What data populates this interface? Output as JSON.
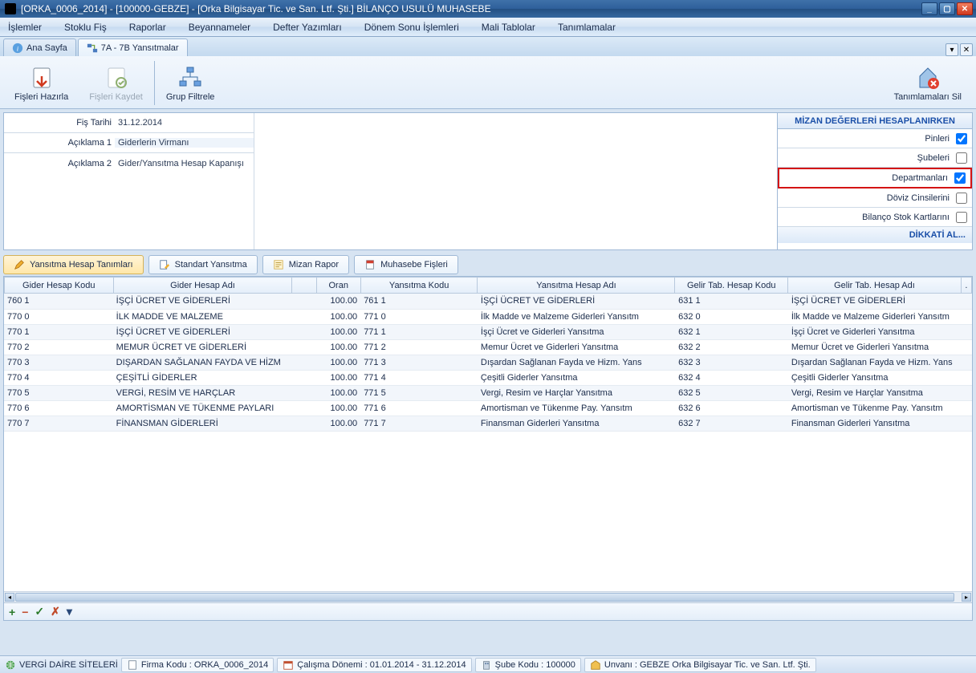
{
  "window": {
    "title": "[ORKA_0006_2014]   -   [100000-GEBZE]   -   [Orka Bilgisayar Tic. ve San. Ltf. Şti.]        BİLANÇO USULÜ MUHASEBE"
  },
  "menu": {
    "items": [
      "İşlemler",
      "Stoklu Fiş",
      "Raporlar",
      "Beyannameler",
      "Defter Yazımları",
      "Dönem Sonu İşlemleri",
      "Mali Tablolar",
      "Tanımlamalar"
    ]
  },
  "doc_tabs": {
    "items": [
      {
        "label": "Ana Sayfa",
        "active": false
      },
      {
        "label": "7A - 7B Yansıtmalar",
        "active": true
      }
    ]
  },
  "ribbon": {
    "fisleri_hazirla": "Fişleri Hazırla",
    "fisleri_kaydet": "Fişleri Kaydet",
    "grup_filtrele": "Grup Filtrele",
    "tanimlamalari_sil": "Tanımlamaları Sil"
  },
  "voucher": {
    "fis_tarihi_label": "Fiş Tarihi",
    "fis_tarihi": "31.12.2014",
    "aciklama1_label": "Açıklama 1",
    "aciklama1": "Giderlerin Virmanı",
    "aciklama2_label": "Açıklama 2",
    "aciklama2": "Gider/Yansıtma Hesap Kapanışı"
  },
  "mizan_panel": {
    "header": "MİZAN DEĞERLERİ HESAPLANIRKEN",
    "rows": [
      {
        "label": "Pinleri",
        "checked": true,
        "highlight": false
      },
      {
        "label": "Şubeleri",
        "checked": false,
        "highlight": false
      },
      {
        "label": "Departmanları",
        "checked": true,
        "highlight": true
      },
      {
        "label": "Döviz Cinsilerini",
        "checked": false,
        "highlight": false
      },
      {
        "label": "Bilanço Stok Kartlarını",
        "checked": false,
        "highlight": false
      }
    ],
    "footer": "DİKKATİ AL..."
  },
  "view_tabs": {
    "items": [
      {
        "label": "Yansıtma Hesap Tanımları",
        "active": true
      },
      {
        "label": "Standart Yansıtma",
        "active": false
      },
      {
        "label": "Mizan Rapor",
        "active": false
      },
      {
        "label": "Muhasebe Fişleri",
        "active": false
      }
    ]
  },
  "grid": {
    "headers": {
      "gider_kodu": "Gider Hesap Kodu",
      "gider_adi": "Gider Hesap Adı",
      "blank": "",
      "oran": "Oran",
      "yansitma_kodu": "Yansıtma Kodu",
      "yansitma_adi": "Yansıtma Hesap Adı",
      "gelir_kodu": "Gelir Tab. Hesap Kodu",
      "gelir_adi": "Gelir Tab. Hesap Adı",
      "last": "."
    },
    "rows": [
      {
        "gk": "760 1",
        "ga": "İŞÇİ ÜCRET VE GİDERLERİ",
        "oran": "100.00",
        "yk": "761 1",
        "ya": "İŞÇİ ÜCRET VE GİDERLERİ",
        "glk": "631 1",
        "gla": "İŞÇİ ÜCRET VE GİDERLERİ"
      },
      {
        "gk": "770 0",
        "ga": "İLK MADDE VE MALZEME",
        "oran": "100.00",
        "yk": "771 0",
        "ya": "İlk Madde ve Malzeme Giderleri Yansıtm",
        "glk": "632 0",
        "gla": "İlk Madde ve Malzeme Giderleri Yansıtm"
      },
      {
        "gk": "770 1",
        "ga": "İŞÇİ ÜCRET VE GİDERLERİ",
        "oran": "100.00",
        "yk": "771 1",
        "ya": "İşçi Ücret ve Giderleri Yansıtma",
        "glk": "632 1",
        "gla": "İşçi Ücret ve Giderleri Yansıtma"
      },
      {
        "gk": "770 2",
        "ga": "MEMUR ÜCRET VE GİDERLERİ",
        "oran": "100.00",
        "yk": "771 2",
        "ya": "Memur Ücret ve Giderleri Yansıtma",
        "glk": "632 2",
        "gla": "Memur Ücret ve Giderleri Yansıtma"
      },
      {
        "gk": "770 3",
        "ga": "DIŞARDAN SAĞLANAN FAYDA VE HİZM",
        "oran": "100.00",
        "yk": "771 3",
        "ya": "Dışardan Sağlanan Fayda ve Hizm. Yans",
        "glk": "632 3",
        "gla": "Dışardan Sağlanan Fayda ve Hizm. Yans"
      },
      {
        "gk": "770 4",
        "ga": "ÇEŞİTLİ GİDERLER",
        "oran": "100.00",
        "yk": "771 4",
        "ya": "Çeşitli Giderler Yansıtma",
        "glk": "632 4",
        "gla": "Çeşitli Giderler Yansıtma"
      },
      {
        "gk": "770 5",
        "ga": "VERGİ, RESİM VE HARÇLAR",
        "oran": "100.00",
        "yk": "771 5",
        "ya": "Vergi, Resim ve Harçlar Yansıtma",
        "glk": "632 5",
        "gla": "Vergi, Resim ve Harçlar Yansıtma"
      },
      {
        "gk": "770 6",
        "ga": "AMORTİSMAN VE TÜKENME PAYLARI",
        "oran": "100.00",
        "yk": "771 6",
        "ya": "Amortisman ve Tükenme Pay. Yansıtm",
        "glk": "632 6",
        "gla": "Amortisman ve Tükenme Pay. Yansıtm"
      },
      {
        "gk": "770 7",
        "ga": "FİNANSMAN GİDERLERİ",
        "oran": "100.00",
        "yk": "771 7",
        "ya": "Finansman Giderleri Yansıtma",
        "glk": "632 7",
        "gla": "Finansman Giderleri Yansıtma"
      }
    ]
  },
  "grid_footer": {
    "add": "+",
    "remove": "−",
    "confirm": "✓",
    "cancel": "✗",
    "more": "▾"
  },
  "statusbar": {
    "vergi": "VERGİ DAİRE SİTELERİ",
    "firma": "Firma Kodu : ORKA_0006_2014",
    "donem": "Çalışma Dönemi : 01.01.2014 - 31.12.2014",
    "sube": "Şube Kodu : 100000",
    "unvan": "Unvanı : GEBZE Orka Bilgisayar Tic. ve San. Ltf. Şti."
  }
}
